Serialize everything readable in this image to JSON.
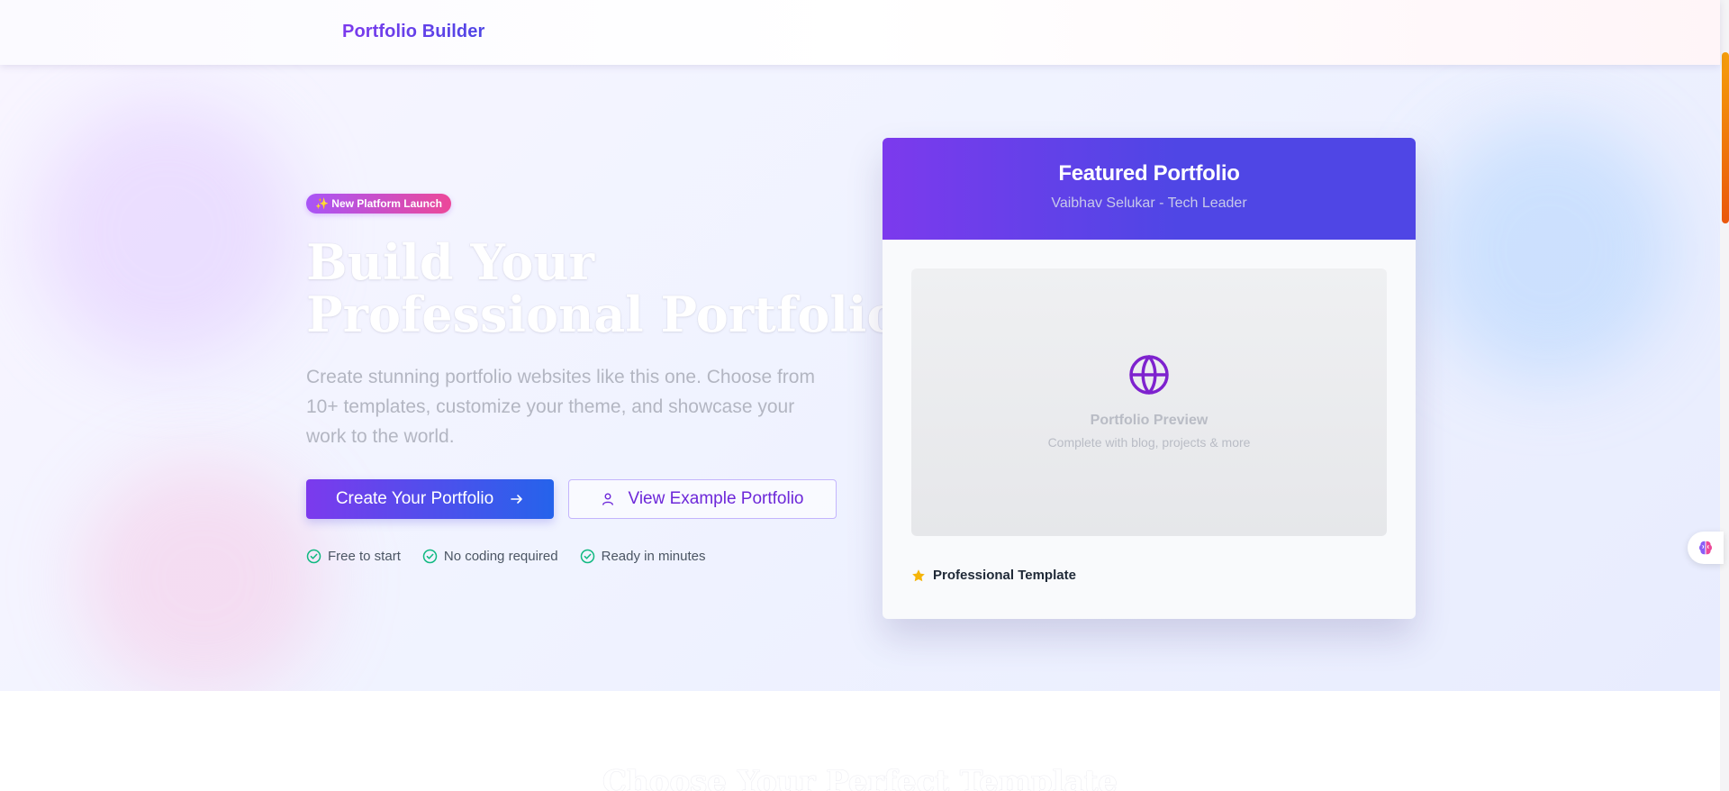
{
  "header": {
    "brand": "Portfolio Builder"
  },
  "hero": {
    "badge": "✨ New Platform Launch",
    "headline_line1": "Build Your",
    "headline_line2": "Professional Portfolio",
    "subtext": "Create stunning portfolio websites like this one. Choose from 10+ templates, customize your theme, and showcase your work to the world.",
    "primary_button": "Create Your Portfolio",
    "secondary_button": "View Example Portfolio",
    "features": [
      "Free to start",
      "No coding required",
      "Ready in minutes"
    ]
  },
  "featured_card": {
    "title": "Featured Portfolio",
    "subtitle": "Vaibhav Selukar - Tech Leader",
    "preview_title": "Portfolio Preview",
    "preview_subtitle": "Complete with blog, projects & more",
    "template_label": "Professional Template"
  },
  "next_section": {
    "title": "Choose Your Perfect Template"
  },
  "icons": {
    "badge": "sparkles-icon",
    "primary_button": "arrow-right-icon",
    "secondary_button": "user-icon",
    "features": "check-circle-icon",
    "preview": "globe-icon",
    "template": "star-icon",
    "widget": "brain-icon"
  },
  "colors": {
    "brand_purple": "#7c3aed",
    "brand_blue": "#2563eb",
    "check_green": "#10b981",
    "star_amber": "#f5b50a",
    "badge_pink": "#ec4899"
  }
}
